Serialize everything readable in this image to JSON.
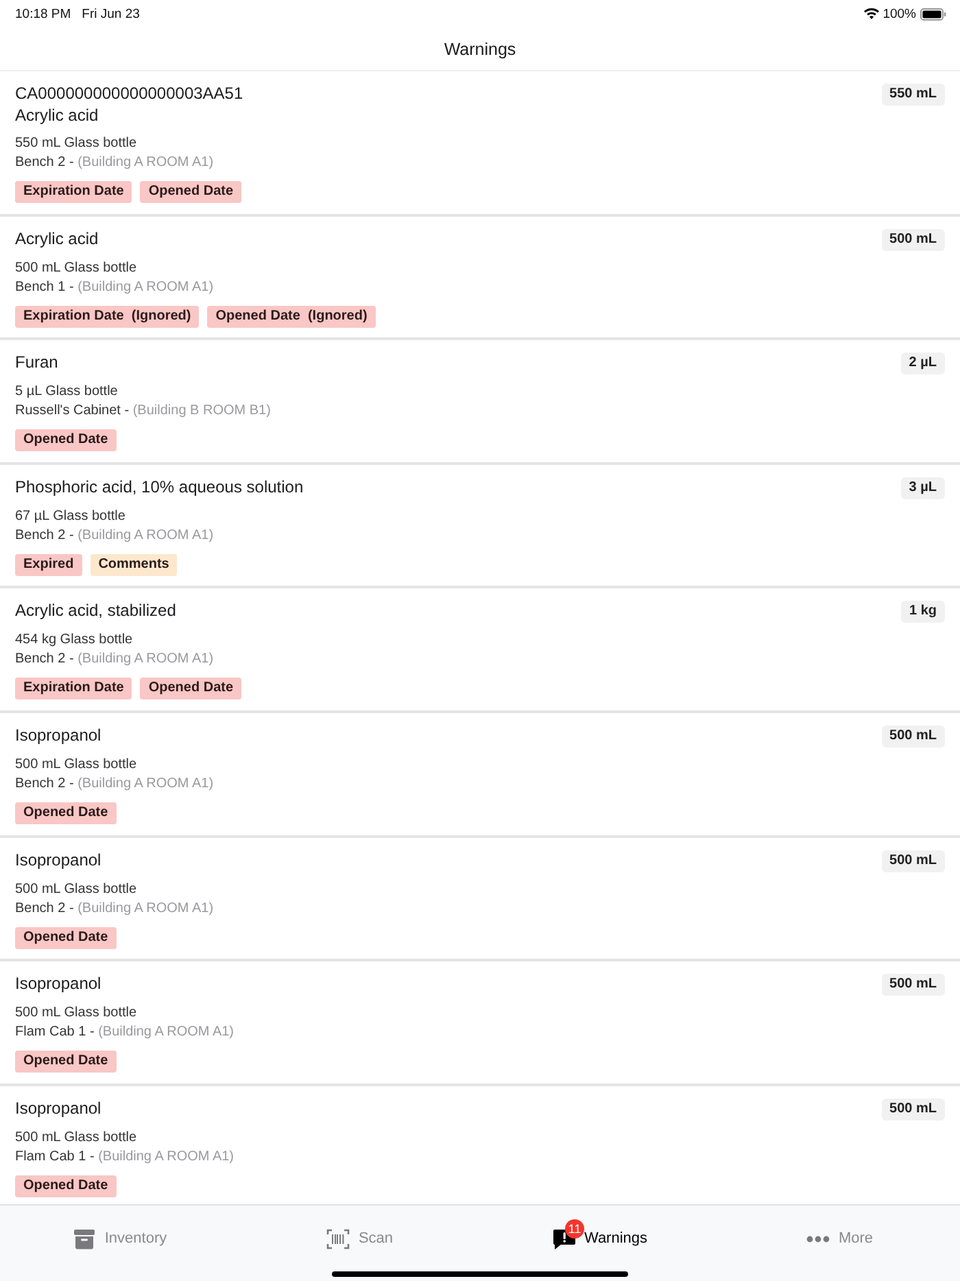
{
  "status_bar": {
    "time": "10:18 PM",
    "date": "Fri Jun 23",
    "battery": "100%"
  },
  "nav": {
    "title": "Warnings"
  },
  "items": [
    {
      "barcode": "CA000000000000000003AA51",
      "name": "Acrylic acid",
      "quantity": "550 mL",
      "container": "550 mL Glass bottle",
      "location": "Bench 2 -",
      "building": "(Building A ROOM A1)",
      "warnings": [
        {
          "label": "Expiration Date",
          "kind": "alert"
        },
        {
          "label": "Opened Date",
          "kind": "alert"
        }
      ]
    },
    {
      "name": "Acrylic acid",
      "quantity": "500 mL",
      "container": "500 mL Glass bottle",
      "location": "Bench 1 -",
      "building": "(Building A ROOM A1)",
      "warnings": [
        {
          "label": "Expiration Date  (Ignored)",
          "kind": "alert"
        },
        {
          "label": "Opened Date  (Ignored)",
          "kind": "alert"
        }
      ]
    },
    {
      "name": "Furan",
      "quantity": "2 µL",
      "container": "5 µL Glass bottle",
      "location": "Russell's Cabinet -",
      "building": "(Building B ROOM B1)",
      "warnings": [
        {
          "label": "Opened Date",
          "kind": "alert"
        }
      ]
    },
    {
      "name": "Phosphoric acid, 10% aqueous solution",
      "quantity": "3 µL",
      "container": "67 µL Glass bottle",
      "location": "Bench 2 -",
      "building": "(Building A ROOM A1)",
      "warnings": [
        {
          "label": "Expired",
          "kind": "alert"
        },
        {
          "label": "Comments",
          "kind": "note"
        }
      ]
    },
    {
      "name": "Acrylic acid, stabilized",
      "quantity": "1 kg",
      "container": "454 kg Glass bottle",
      "location": "Bench 2 -",
      "building": "(Building A ROOM A1)",
      "warnings": [
        {
          "label": "Expiration Date",
          "kind": "alert"
        },
        {
          "label": "Opened Date",
          "kind": "alert"
        }
      ]
    },
    {
      "name": "Isopropanol",
      "quantity": "500 mL",
      "container": "500 mL Glass bottle",
      "location": "Bench 2 -",
      "building": "(Building A ROOM A1)",
      "warnings": [
        {
          "label": "Opened Date",
          "kind": "alert"
        }
      ]
    },
    {
      "name": "Isopropanol",
      "quantity": "500 mL",
      "container": "500 mL Glass bottle",
      "location": "Bench 2 -",
      "building": "(Building A ROOM A1)",
      "warnings": [
        {
          "label": "Opened Date",
          "kind": "alert"
        }
      ]
    },
    {
      "name": "Isopropanol",
      "quantity": "500 mL",
      "container": "500 mL Glass bottle",
      "location": "Flam Cab 1 -",
      "building": "(Building A ROOM A1)",
      "warnings": [
        {
          "label": "Opened Date",
          "kind": "alert"
        }
      ]
    },
    {
      "name": "Isopropanol",
      "quantity": "500 mL",
      "container": "500 mL Glass bottle",
      "location": "Flam Cab 1 -",
      "building": "(Building A ROOM A1)",
      "warnings": [
        {
          "label": "Opened Date",
          "kind": "alert"
        }
      ]
    }
  ],
  "tab_bar": {
    "tabs": [
      {
        "label": "Inventory",
        "selected": false
      },
      {
        "label": "Scan",
        "selected": false
      },
      {
        "label": "Warnings",
        "selected": true,
        "badge": "11"
      },
      {
        "label": "More",
        "selected": false
      }
    ]
  }
}
